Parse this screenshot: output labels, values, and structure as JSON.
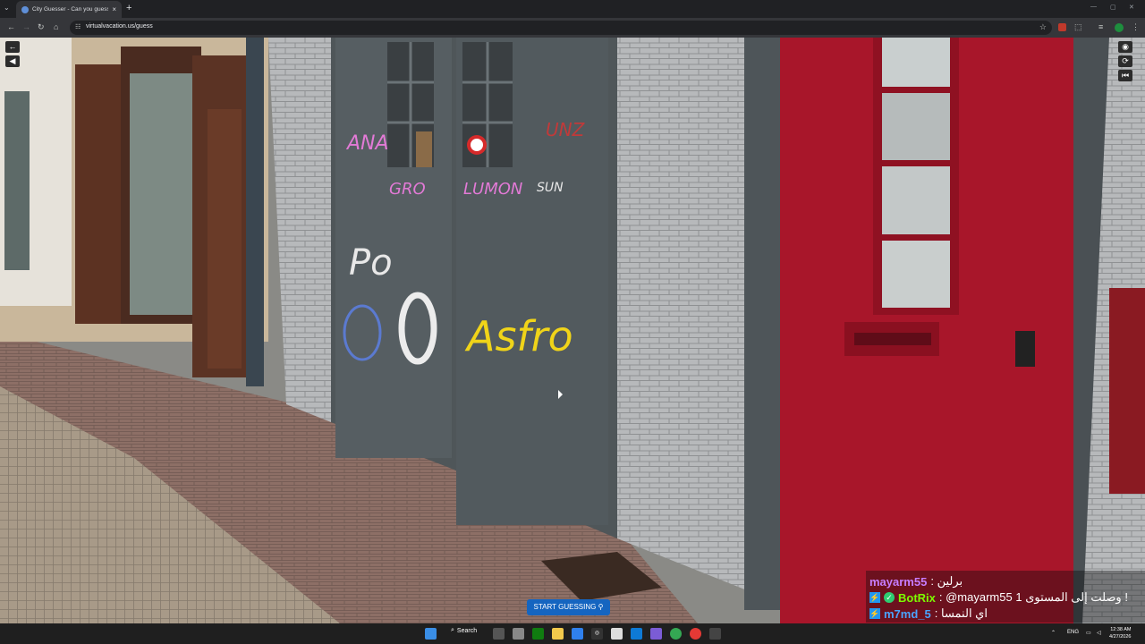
{
  "browser": {
    "tab_title": "City Guesser - Can you guess w",
    "new_tab_symbol": "+",
    "close_symbol": "×",
    "url": "virtualvacation.us/guess"
  },
  "game": {
    "start_button": "START GUESSING"
  },
  "chat": {
    "messages": [
      {
        "user": "mayarm55",
        "text": ": برلين",
        "color": "#c77dff"
      },
      {
        "user": "BotRix",
        "text": ": @mayarm55 وصلت إلى المستوى 1 !",
        "color": "#7cfc00"
      },
      {
        "user": "m7md_5",
        "text": ": اي النمسا",
        "color": "#4aa3ff"
      }
    ]
  },
  "taskbar": {
    "search_label": "Search",
    "language": "ENG",
    "time": "12:38 AM",
    "date": "4/27/2026"
  },
  "icons": [
    "back-icon",
    "forward-icon",
    "reload-icon",
    "home-icon",
    "star-icon",
    "windows-start-icon",
    "search-icon",
    "map-pin-icon",
    "compass-icon",
    "reset-icon",
    "undo-icon"
  ]
}
